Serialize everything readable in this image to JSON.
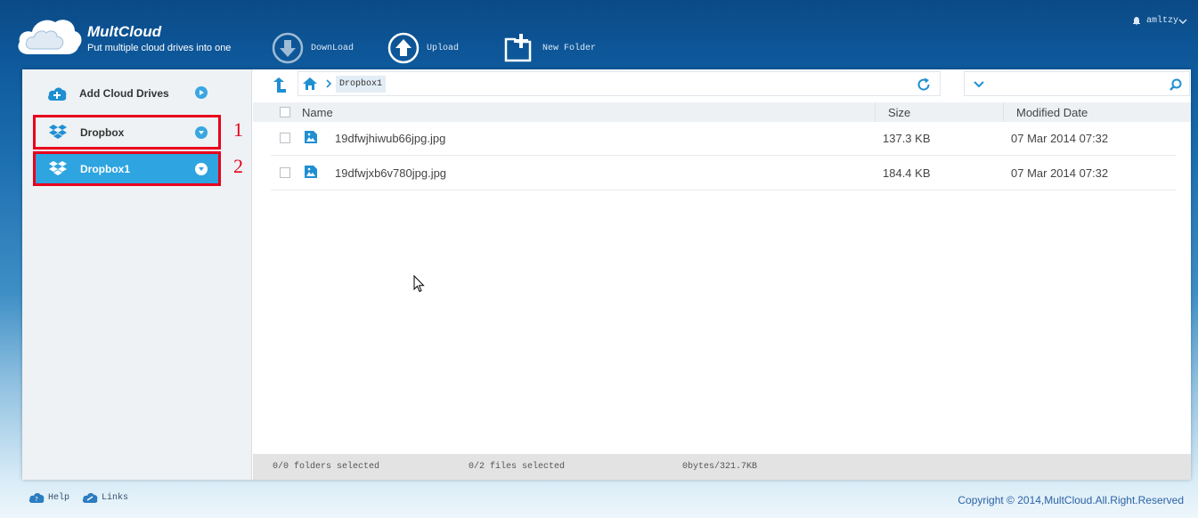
{
  "brand": {
    "name": "MultCloud",
    "tagline": "Put multiple cloud drives into one"
  },
  "toolbar": {
    "download_label": "DownLoad",
    "upload_label": "Upload",
    "new_folder_label": "New Folder"
  },
  "user": {
    "name": "amltzy"
  },
  "sidebar": {
    "add_label": "Add Cloud Drives",
    "drives": [
      {
        "label": "Dropbox",
        "annotation": "1"
      },
      {
        "label": "Dropbox1",
        "annotation": "2"
      }
    ]
  },
  "breadcrumb": {
    "current": "Dropbox1"
  },
  "search": {
    "placeholder": ""
  },
  "table": {
    "headers": {
      "name": "Name",
      "size": "Size",
      "date": "Modified Date"
    },
    "rows": [
      {
        "name": "19dfwjhiwub66jpg.jpg",
        "size": "137.3 KB",
        "date": "07 Mar 2014 07:32"
      },
      {
        "name": "19dfwjxb6v780jpg.jpg",
        "size": "184.4 KB",
        "date": "07 Mar 2014 07:32"
      }
    ]
  },
  "status": {
    "folders": "0/0 folders selected",
    "files": "0/2 files selected",
    "bytes": "0bytes/321.7KB"
  },
  "footer": {
    "help_label": "Help",
    "links_label": "Links",
    "copyright": "Copyright © 2014,MultCloud.All.Right.Reserved"
  },
  "colors": {
    "accent": "#2ea4e0",
    "icon_blue": "#1f8fd2",
    "annotation_red": "#e8001c"
  }
}
